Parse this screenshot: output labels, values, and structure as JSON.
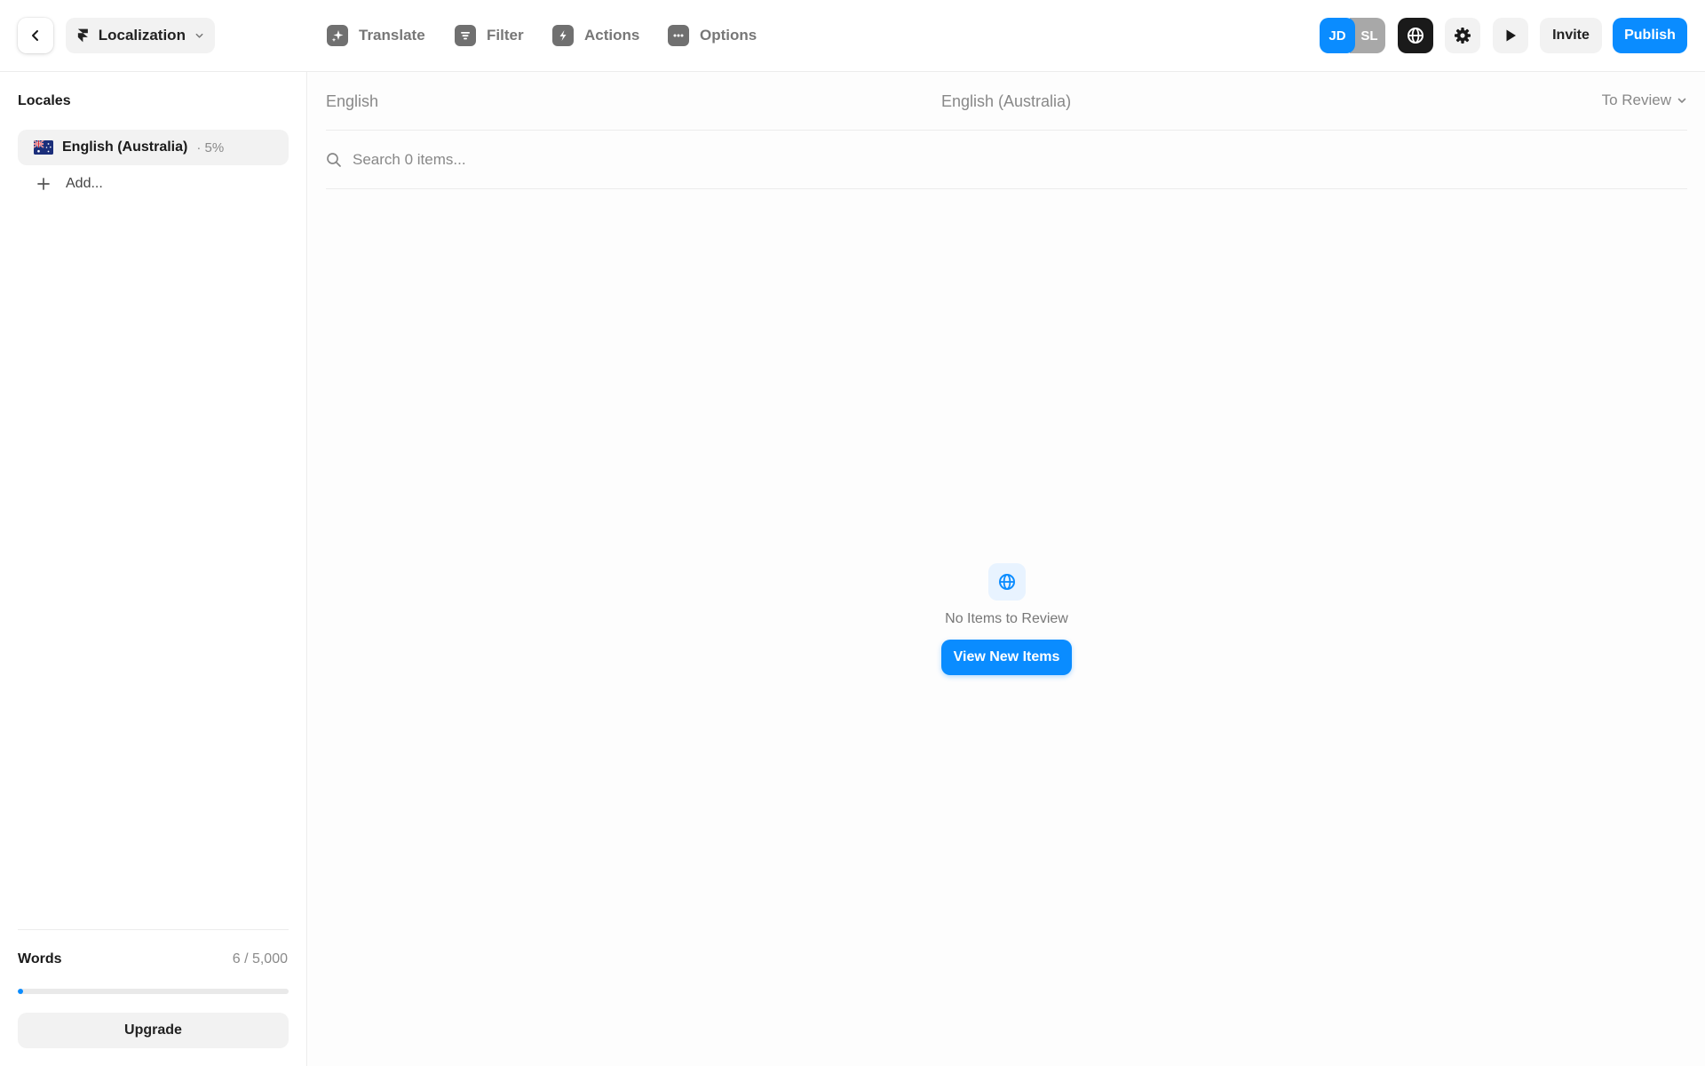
{
  "colors": {
    "accent": "#0a8cff",
    "muted_text": "#888888",
    "panel": "#f2f2f2"
  },
  "topbar": {
    "back_icon": "chevron-left-icon",
    "project": {
      "label": "Localization",
      "icon": "framer-logo-icon",
      "chevron": "chevron-down-icon"
    },
    "tools": [
      {
        "label": "Translate",
        "icon": "sparkle-icon"
      },
      {
        "label": "Filter",
        "icon": "filter-icon"
      },
      {
        "label": "Actions",
        "icon": "bolt-icon"
      },
      {
        "label": "Options",
        "icon": "ellipsis-icon"
      }
    ],
    "avatars": [
      {
        "initials": "JD",
        "color": "#0a8cff"
      },
      {
        "initials": "SL",
        "color": "#a8a8a8"
      }
    ],
    "icon_buttons": [
      {
        "icon": "globe-icon"
      },
      {
        "icon": "gear-icon"
      },
      {
        "icon": "play-icon"
      }
    ],
    "invite_label": "Invite",
    "publish_label": "Publish"
  },
  "sidebar": {
    "title": "Locales",
    "locales": [
      {
        "name": "English (Australia)",
        "percent": "· 5%",
        "flag": "australia-flag-icon"
      }
    ],
    "add_label": "Add...",
    "words": {
      "label": "Words",
      "count": "6 / 5,000",
      "progress": 0.0012
    },
    "upgrade_label": "Upgrade"
  },
  "main": {
    "source_column": "English",
    "target_column": "English (Australia)",
    "status_filter": "To Review",
    "search": {
      "placeholder": "Search 0 items..."
    },
    "empty_state": {
      "icon": "globe-icon",
      "message": "No Items to Review",
      "button_label": "View New Items"
    }
  }
}
